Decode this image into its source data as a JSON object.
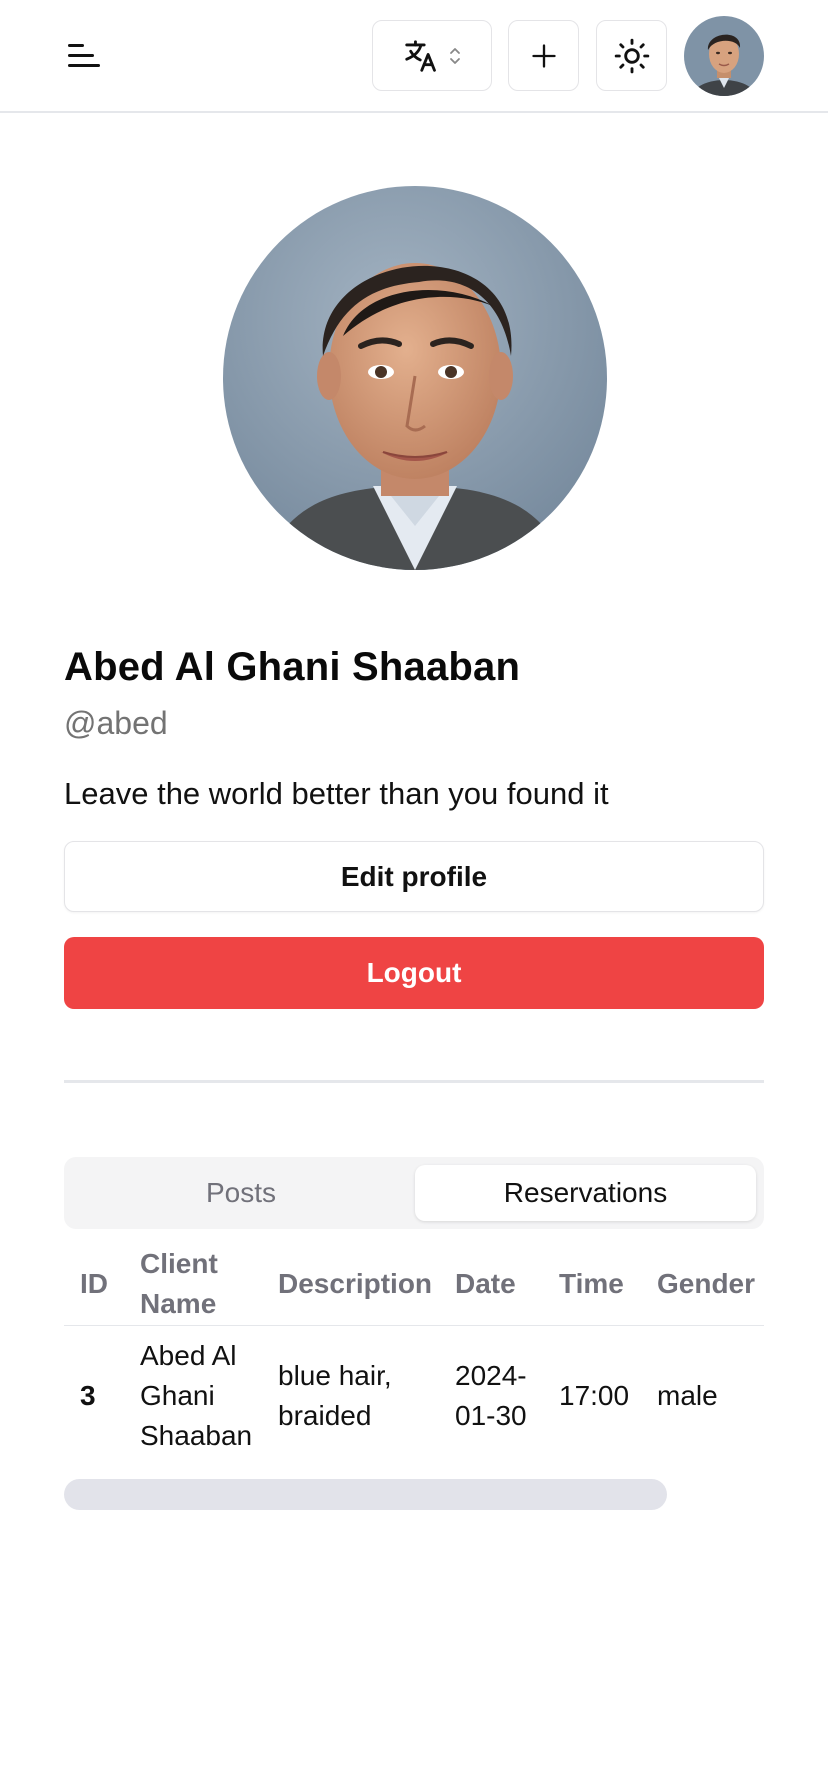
{
  "header": {
    "menu_icon": "menu-icon",
    "language_icon": "translate-icon",
    "language_chevron_icon": "chevrons-up-down-icon",
    "add_icon": "plus-icon",
    "theme_icon": "sun-icon",
    "avatar": "user-avatar"
  },
  "profile": {
    "name": "Abed Al Ghani Shaaban",
    "handle": "@abed",
    "bio": "Leave the world better than you found it",
    "edit_label": "Edit profile",
    "logout_label": "Logout"
  },
  "tabs": [
    {
      "label": "Posts",
      "active": false
    },
    {
      "label": "Reservations",
      "active": true
    }
  ],
  "table": {
    "headers": {
      "id": "ID",
      "client_line1": "Client",
      "client_line2": "Name",
      "description": "Description",
      "date": "Date",
      "time": "Time",
      "gender": "Gender"
    },
    "rows": [
      {
        "id": "3",
        "client_line1": "Abed Al",
        "client_line2": "Ghani",
        "client_line3": "Shaaban",
        "desc_line1": "blue hair,",
        "desc_line2": "braided",
        "date_line1": "2024-",
        "date_line2": "01-30",
        "time": "17:00",
        "gender": "male"
      }
    ]
  },
  "colors": {
    "logout": "#ef4444",
    "muted_text": "#71717a",
    "border": "#e4e4e7"
  }
}
